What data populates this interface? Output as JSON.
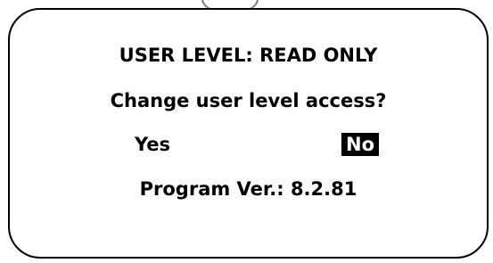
{
  "dialog": {
    "title": "USER LEVEL: READ ONLY",
    "question": "Change user level access?",
    "options": [
      {
        "label": "Yes",
        "selected": false
      },
      {
        "label": "No",
        "selected": true
      }
    ],
    "version_text": "Program Ver.: 8.2.81"
  },
  "colors": {
    "background": "#ffffff",
    "text": "#000000",
    "selected_bg": "#000000",
    "selected_text": "#ffffff"
  }
}
